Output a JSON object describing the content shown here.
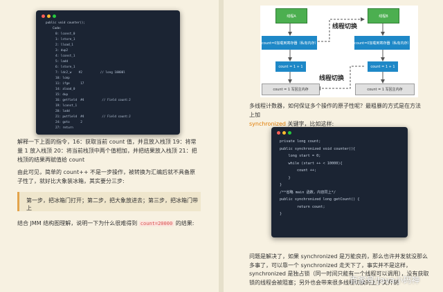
{
  "left": {
    "bytecode_header": "public void counter();",
    "bytecode_code_label": "Code:",
    "bytecode_lines": [
      "0: lconst_0",
      "1: lstore_1",
      "2: lload_1",
      "3: dup2",
      "4: lconst_1",
      "5: ladd",
      "6: lstore_1",
      "7: ldc2_w    #2          // long 10000l",
      "10: lcmp",
      "11: ifge      17",
      "14: aload_0",
      "15: dup",
      "16: getfield  #4          // Field count:J",
      "19: lconst_1",
      "20: ladd",
      "21: putfield  #4          // Field count:J",
      "24: goto      2",
      "27: return"
    ],
    "p1": "解释一下上面的指令，16：获取当前 count 值，并且放入栈顶 19：将常量 1 放入栈顶 20：将当前栈顶中两个值相加，并把结果放入栈顶 21：把栈顶的结果再赋值给 count",
    "p2": "由此可见，简单的 count++ 不是一步操作，被转换为汇编后就不具备原子性了，就好比大象装冰箱，其实要分三步:",
    "quote": "第一步，把冰箱门打开；第二步，把大象放进去；第三步，把冰箱门带上",
    "p3_before": "结合 JMM 结构图理解，说明一下为什么很难得到",
    "p3_code": "count=20000",
    "p3_after": "的结果:"
  },
  "right": {
    "diagram": {
      "thread_a": "线程A",
      "thread_b": "线程B",
      "switch_top": "线程切换",
      "switch_bottom": "线程切换",
      "reg_a": "count=0加载到寄存器（私有内存）",
      "reg_b": "count=0加载到寄存器（私有内存）",
      "count_a": "count = 1 + 1",
      "count_b": "count = 1 + 1",
      "mem_a": "count = 1 写回主内存",
      "mem_b": "count = 1 写回主内存"
    },
    "p1": "多线程计数器，如何保证多个操作的原子性呢？最粗暴的方式是在方法上加",
    "p1_keyword": "synchronized",
    "p1_after": "关键字，比如这样:",
    "code_lines": [
      "private long count;",
      "",
      "public synchronized void counter(){",
      "    long start = 0;",
      "    while (start ++ < 10000){",
      "        count ++;",
      "    }",
      "}",
      "",
      "/**省略 main 函数，内容同上*/",
      "",
      "public synchronized long getCount() {",
      "        return count;",
      "}"
    ],
    "p2": "问题是解决了，如果 synchronized 是万能良药，那么也许并发就没那么多事了，可以靠一个 synchronized 走天下了，事实并不是这样，synchronized 是独占锁（同一时间只能有一个线程可以调用），没有获取锁的线程会被阻塞；另外也会带来很多线程切换的上下文开销",
    "watermark": "百家号/Java小码神"
  },
  "colors": {
    "dot_red": "#ff5f56",
    "dot_yellow": "#ffbd2e",
    "dot_green": "#27c93f"
  }
}
